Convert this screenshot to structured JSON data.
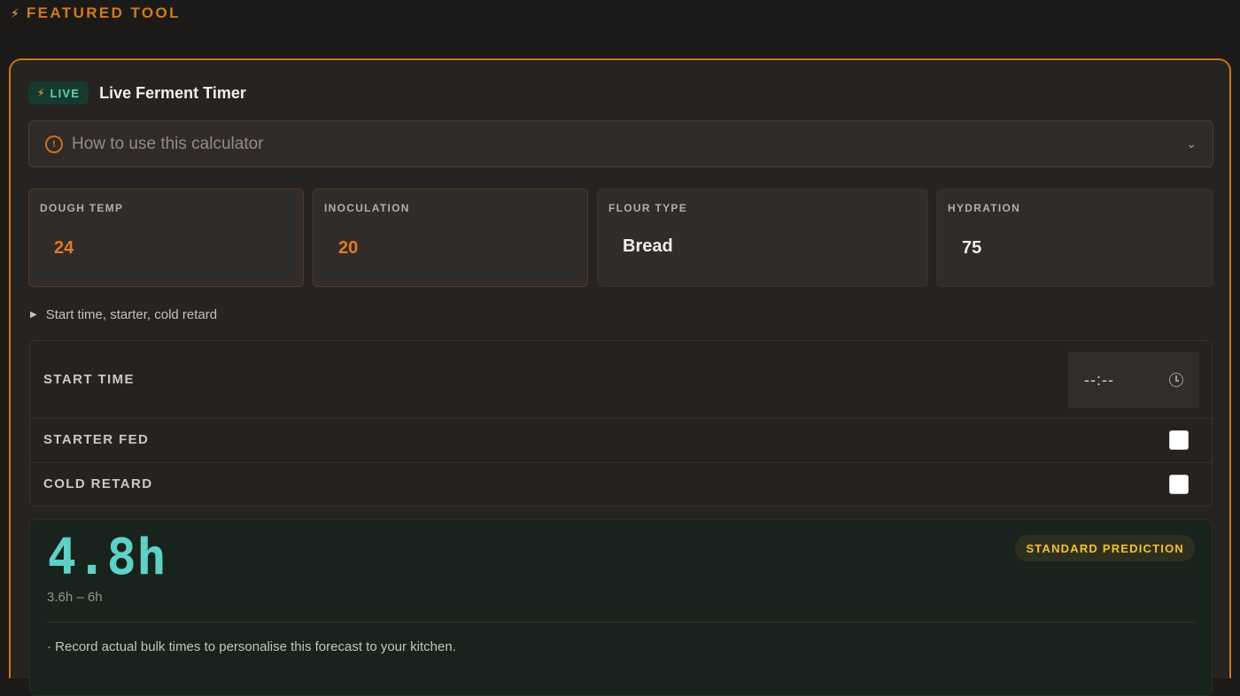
{
  "section": {
    "featured_label": "FEATURED TOOL"
  },
  "card": {
    "badge": "LIVE",
    "title": "Live Ferment Timer",
    "howto_label": "How to use this calculator"
  },
  "fields": [
    {
      "label": "DOUGH TEMP",
      "value": "24"
    },
    {
      "label": "INOCULATION",
      "value": "20"
    },
    {
      "label": "FLOUR TYPE",
      "value": "Bread"
    },
    {
      "label": "HYDRATION",
      "value": "75"
    }
  ],
  "details": {
    "summary": "Start time, starter, cold retard"
  },
  "options": {
    "start_time_label": "START TIME",
    "start_time_value": "--:--",
    "starter_fed_label": "STARTER FED",
    "starter_fed_checked": false,
    "cold_retard_label": "COLD RETARD",
    "cold_retard_checked": false
  },
  "result": {
    "value": "4.8h",
    "range": "3.6h – 6h",
    "badge": "STANDARD PREDICTION",
    "note": "· Record actual bulk times to personalise this forecast to your kitchen."
  },
  "colors": {
    "accent_orange": "#c9731d",
    "live_teal": "#5fd0b4",
    "result_teal": "#5fd0c6",
    "badge_yellow": "#f2c230"
  },
  "icons": [
    "lightning-icon",
    "info-icon",
    "chevron-down-icon",
    "triangle-right-icon",
    "clock-icon"
  ]
}
